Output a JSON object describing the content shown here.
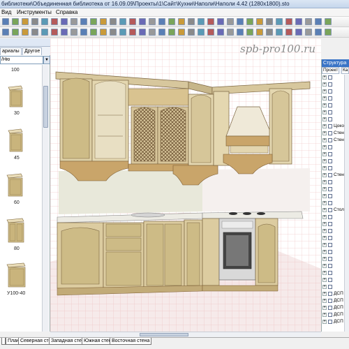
{
  "window": {
    "title": "библиотеки\\Объединенная библиотека от 16.09.09\\Проекты\\1\\Сайт\\Кухни\\Наполи\\Наполи 4.42 (1280x1800).sto"
  },
  "menu": {
    "items": [
      "Вид",
      "Инструменты",
      "Справка"
    ]
  },
  "left_panel": {
    "header": "",
    "tabs": [
      "ариалы",
      "Другое"
    ],
    "select_value": "/Ню",
    "items": [
      {
        "label": "100"
      },
      {
        "label": "30"
      },
      {
        "label": "45"
      },
      {
        "label": "60"
      },
      {
        "label": "80"
      },
      {
        "label": "У100-40"
      }
    ]
  },
  "canvas": {
    "watermark": "spb-pro100.ru"
  },
  "right_panel": {
    "header": "Структура",
    "tabs": [
      "Проект",
      "Ка"
    ],
    "tree": [
      {
        "label": ""
      },
      {
        "label": ""
      },
      {
        "label": ""
      },
      {
        "label": ""
      },
      {
        "label": ""
      },
      {
        "label": ""
      },
      {
        "label": ""
      },
      {
        "label": "Цоко"
      },
      {
        "label": "Стен"
      },
      {
        "label": "Стен"
      },
      {
        "label": ""
      },
      {
        "label": ""
      },
      {
        "label": ""
      },
      {
        "label": ""
      },
      {
        "label": "Стен"
      },
      {
        "label": ""
      },
      {
        "label": ""
      },
      {
        "label": ""
      },
      {
        "label": ""
      },
      {
        "label": "Стол"
      },
      {
        "label": ""
      },
      {
        "label": ""
      },
      {
        "label": ""
      },
      {
        "label": ""
      },
      {
        "label": ""
      },
      {
        "label": ""
      },
      {
        "label": ""
      },
      {
        "label": ""
      },
      {
        "label": ""
      },
      {
        "label": ""
      },
      {
        "label": ""
      },
      {
        "label": "ДСП"
      },
      {
        "label": "ДСП"
      },
      {
        "label": "ДСП"
      },
      {
        "label": "ДСП"
      },
      {
        "label": "ДСП"
      }
    ]
  },
  "view_tabs": [
    "План",
    "Северная стена",
    "Западная стена",
    "Южная стена",
    "Восточная стена"
  ]
}
